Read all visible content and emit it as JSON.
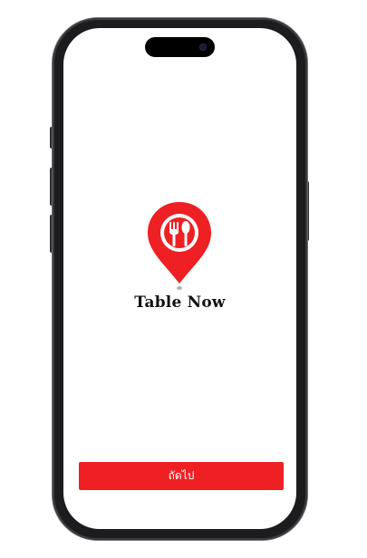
{
  "app": {
    "title": "Table Now"
  },
  "actions": {
    "next_label": "ถัดไป"
  },
  "icons": {
    "logo": "map-pin-fork-spoon-icon",
    "camera": "front-camera-icon"
  },
  "colors": {
    "brand_red": "#ee2024",
    "frame": "#1c1c1e",
    "screen_bg": "#ffffff"
  }
}
